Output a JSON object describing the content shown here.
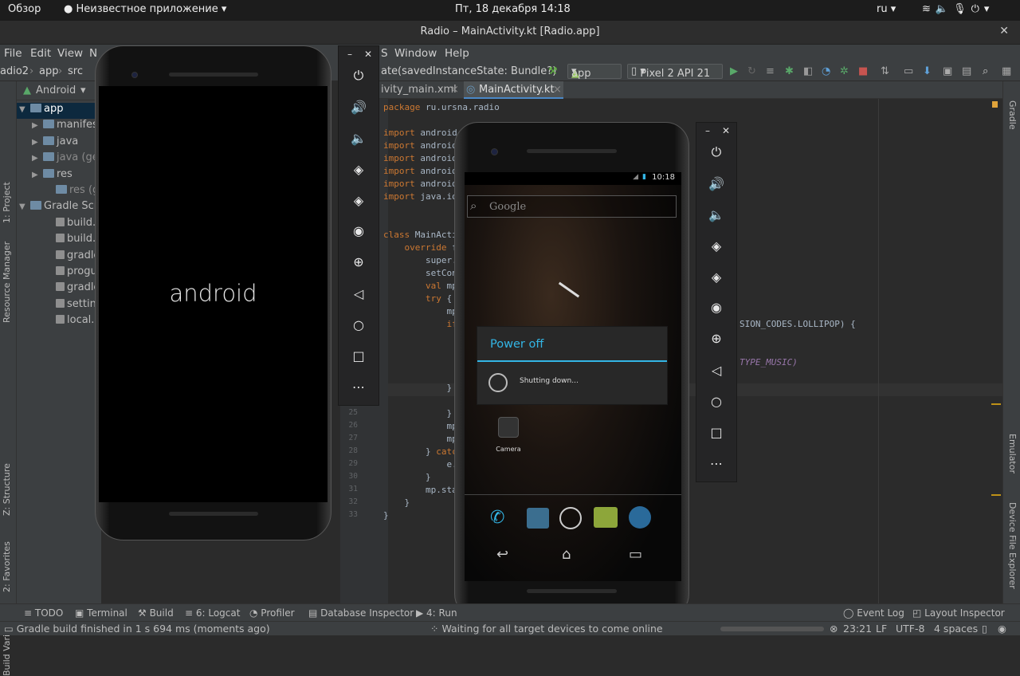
{
  "gnome": {
    "overview": "Обзор",
    "app_name": "Неизвестное приложение",
    "clock": "Пт, 18 декабря  14:18",
    "lang": "ru"
  },
  "window": {
    "title": "Radio – MainActivity.kt [Radio.app]"
  },
  "menu": [
    "File",
    "Edit",
    "View",
    "N",
    "S",
    "Window",
    "Help"
  ],
  "nav": {
    "crumb1": "adio2",
    "crumb2": "app",
    "crumb3": "src",
    "method": "ate(savedInstanceState: Bundle?)",
    "run_config": "app",
    "device": "Pixel 2 API 21"
  },
  "tabs": [
    "ivity_main.xml",
    "MainActivity.kt"
  ],
  "project": {
    "mode": "Android",
    "items": [
      {
        "label": "app",
        "indent": 0,
        "sel": true
      },
      {
        "label": "manifes",
        "indent": 1
      },
      {
        "label": "java",
        "indent": 1
      },
      {
        "label": "java (ge",
        "indent": 1
      },
      {
        "label": "res",
        "indent": 1
      },
      {
        "label": "res (gen",
        "indent": 2
      },
      {
        "label": "Gradle Scri",
        "indent": 0
      },
      {
        "label": "build.gr",
        "indent": 2
      },
      {
        "label": "build.gr",
        "indent": 2
      },
      {
        "label": "gradle-w",
        "indent": 2
      },
      {
        "label": "proguar",
        "indent": 2
      },
      {
        "label": "gradle.p",
        "indent": 2
      },
      {
        "label": "settings",
        "indent": 2
      },
      {
        "label": "local.pro",
        "indent": 2
      }
    ]
  },
  "side_left": [
    "1: Project",
    "Resource Manager",
    "Z: Structure",
    "2: Favorites",
    "Build Variants"
  ],
  "side_right": [
    "Gradle",
    "Emulator",
    "Device File Explorer"
  ],
  "code": [
    {
      "n": "",
      "t": "package ru.ursna.radio"
    },
    {
      "n": "",
      "t": "import android."
    },
    {
      "n": "",
      "t": "import android"
    },
    {
      "n": "",
      "t": "import android"
    },
    {
      "n": "",
      "t": "import android"
    },
    {
      "n": "",
      "t": "import android"
    },
    {
      "n": "",
      "t": "import java.io"
    },
    {
      "n": "",
      "t": "class MainActivi"
    },
    {
      "n": "",
      "t": "    override f"
    },
    {
      "n": "",
      "t": "        super."
    },
    {
      "n": "",
      "t": "        setCon"
    },
    {
      "n": "",
      "t": "        val mp"
    },
    {
      "n": "",
      "t": "        try {"
    },
    {
      "n": "",
      "t": "            mp"
    },
    {
      "n": "",
      "t": "            if"
    },
    {
      "n": "",
      "t": "            }"
    },
    {
      "n": "25",
      "t": "            }"
    },
    {
      "n": "26",
      "t": "            mp"
    },
    {
      "n": "27",
      "t": "            mp"
    },
    {
      "n": "28",
      "t": "        } catc"
    },
    {
      "n": "29",
      "t": "            e."
    },
    {
      "n": "30",
      "t": "        }"
    },
    {
      "n": "31",
      "t": "        mp.sta"
    },
    {
      "n": "32",
      "t": "    }"
    },
    {
      "n": "33",
      "t": "}"
    }
  ],
  "code_right": {
    "l1": "SION_CODES.LOLLIPOP) {",
    "l2": "TYPE_MUSIC)"
  },
  "phone1": {
    "boot": "android"
  },
  "phone2": {
    "time": "10:18",
    "search": "Google",
    "dialog_title": "Power off",
    "dialog_msg": "Shutting down...",
    "camera": "Camera"
  },
  "bottom_tools": [
    "TODO",
    "Terminal",
    "Build",
    "6: Logcat",
    "Profiler",
    "Database Inspector",
    "4: Run",
    "Event Log",
    "Layout Inspector"
  ],
  "status": {
    "left": "Gradle build finished in 1 s 694 ms (moments ago)",
    "mid": "Waiting for all target devices to come online",
    "pos": "23:21",
    "lf": "LF",
    "enc": "UTF-8",
    "indent": "4 spaces"
  }
}
